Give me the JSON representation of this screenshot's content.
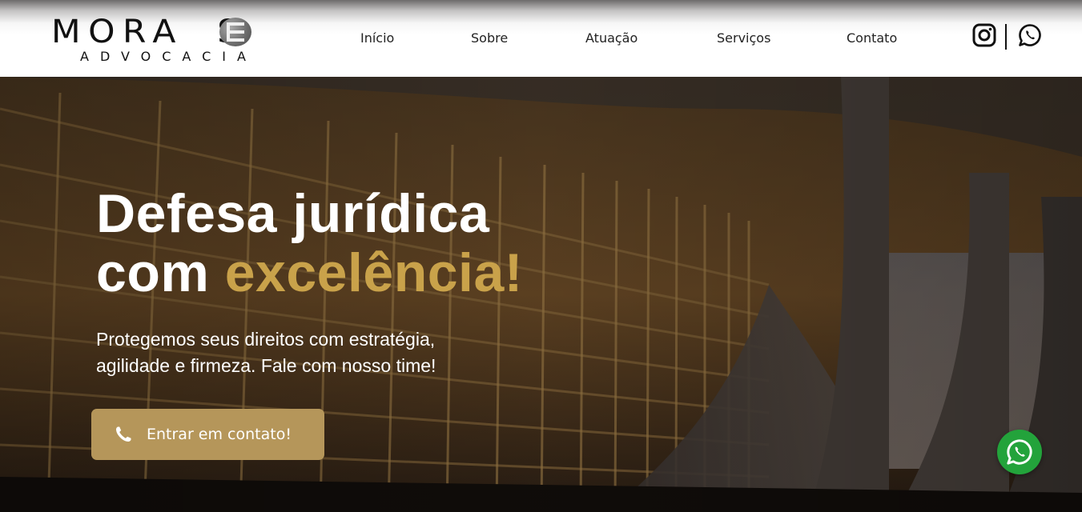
{
  "brand": {
    "name_top": "MORA",
    "name_tail": "S",
    "name_sub": "ADVOCACIA"
  },
  "nav": {
    "items": [
      {
        "label": "Início"
      },
      {
        "label": "Sobre"
      },
      {
        "label": "Atuação"
      },
      {
        "label": "Serviços"
      },
      {
        "label": "Contato"
      }
    ]
  },
  "social": {
    "instagram_icon": "instagram-icon",
    "whatsapp_icon": "whatsapp-icon"
  },
  "hero": {
    "headline_line1": "Defesa jurídica",
    "headline_line2_start": "com ",
    "headline_line2_accent": "excelência!",
    "subhead_line1": "Protegemos seus direitos com estratégia,",
    "subhead_line2": "agilidade e firmeza. Fale com nosso time!",
    "cta_label": "Entrar em contato!",
    "cta_icon": "phone-icon"
  },
  "floating": {
    "icon": "whatsapp-icon"
  },
  "colors": {
    "accent_gold": "#c9a24a",
    "button_gold": "#b5965a",
    "whatsapp_green": "#23a33b",
    "text_dark": "#111111"
  }
}
